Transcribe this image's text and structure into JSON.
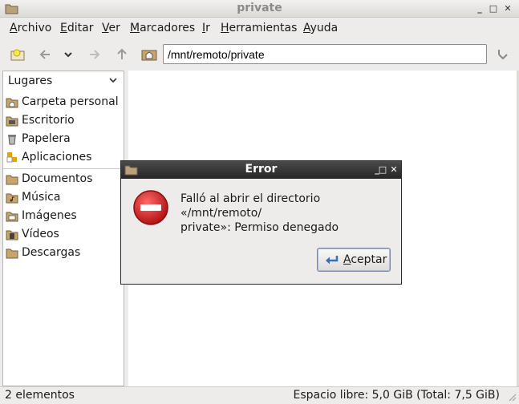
{
  "window": {
    "title": "private"
  },
  "menu": {
    "items": [
      "Archivo",
      "Editar",
      "Ver",
      "Marcadores",
      "Ir",
      "Herramientas",
      "Ayuda"
    ]
  },
  "toolbar": {
    "location_value": "/mnt/remoto/private"
  },
  "sidebar": {
    "header": "Lugares",
    "places": [
      {
        "label": "Carpeta personal",
        "icon": "home-folder-icon"
      },
      {
        "label": "Escritorio",
        "icon": "desktop-folder-icon"
      },
      {
        "label": "Papelera",
        "icon": "trash-icon"
      },
      {
        "label": "Aplicaciones",
        "icon": "applications-icon"
      }
    ],
    "bookmarks": [
      {
        "label": "Documentos",
        "icon": "folder-icon"
      },
      {
        "label": "Música",
        "icon": "music-folder-icon"
      },
      {
        "label": "Imágenes",
        "icon": "pictures-folder-icon"
      },
      {
        "label": "Vídeos",
        "icon": "videos-folder-icon"
      },
      {
        "label": "Descargas",
        "icon": "downloads-folder-icon"
      }
    ]
  },
  "statusbar": {
    "items_count": "2 elementos",
    "free_space": "Espacio libre: 5,0 GiB (Total: 7,5 GiB)"
  },
  "dialog": {
    "title": "Error",
    "message": "Falló al abrir el directorio «/mnt/remoto/ private»: Permiso denegado",
    "message_line1": "Falló al abrir el directorio «/mnt/remoto/",
    "message_line2": "private»: Permiso denegado",
    "ok_label": "Aceptar"
  },
  "colors": {
    "dialog_titlebar": "#262626",
    "error_red": "#d02020",
    "folder": "#c9a56b"
  }
}
